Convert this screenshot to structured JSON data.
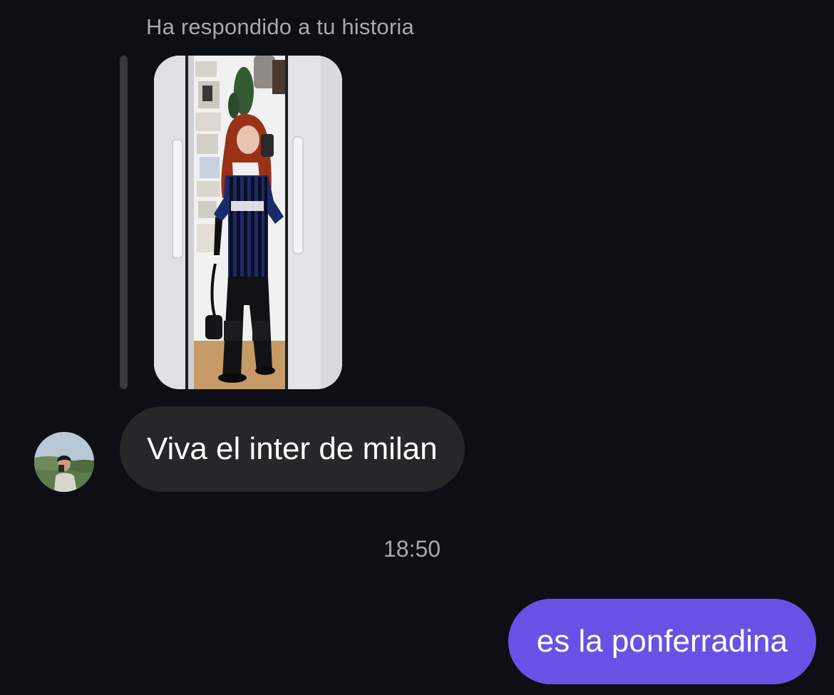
{
  "chat": {
    "story_reply_label": "Ha respondido a tu historia",
    "incoming_message": "Viva el inter de milan",
    "timestamp": "18:50",
    "outgoing_message": "es la ponferradina"
  },
  "colors": {
    "background": "#0c1014",
    "incoming_bubble": "#262729",
    "outgoing_bubble": "#6852e6",
    "meta_text": "#a8a8ad",
    "quote_bar": "#38393d"
  }
}
